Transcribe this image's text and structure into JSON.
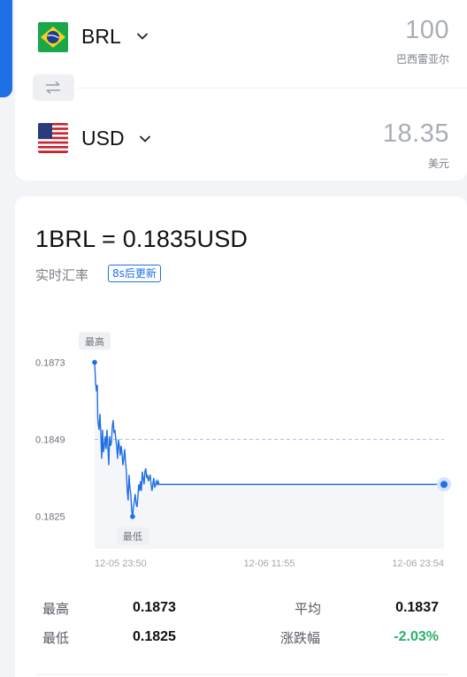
{
  "converter": {
    "from": {
      "flag": "brazil-flag",
      "code": "BRL",
      "amount": "100",
      "name": "巴西雷亚尔"
    },
    "to": {
      "flag": "us-flag",
      "code": "USD",
      "amount": "18.35",
      "name": "美元"
    },
    "swap_icon": "swap-arrows-icon"
  },
  "rate": {
    "title": "1BRL = 0.1835USD",
    "subtitle": "实时汇率",
    "refresh_badge": "8s后更新"
  },
  "chart_data": {
    "type": "line",
    "title": "",
    "xlabel": "",
    "ylabel": "",
    "y_ticks": [
      "0.1873",
      "0.1849",
      "0.1825"
    ],
    "x_ticks": [
      "12-05 23:50",
      "12-06 11:55",
      "12-06 23:54"
    ],
    "ylim": [
      0.1815,
      0.188
    ],
    "average_line": 0.1849,
    "high_label": "最高",
    "low_label": "最低",
    "series": [
      {
        "x": [
          0,
          1,
          2,
          3,
          3.5,
          4,
          5,
          6,
          7,
          8,
          9,
          10,
          11,
          12,
          13,
          14,
          15,
          16,
          17,
          18,
          19,
          20,
          21,
          22,
          23,
          24,
          25,
          26,
          27,
          28,
          29,
          30,
          31,
          32,
          33,
          34,
          35,
          36,
          37,
          38,
          39,
          40,
          41,
          42,
          43,
          44,
          45,
          46,
          47,
          48,
          49,
          50,
          51,
          52,
          53,
          54,
          55,
          56,
          57,
          58,
          59,
          60,
          61,
          62,
          63,
          64,
          65,
          66,
          67,
          68,
          69,
          70,
          71,
          72,
          73,
          74,
          75,
          76,
          77,
          78,
          79,
          80,
          85,
          90,
          100,
          120,
          160,
          200,
          250,
          300,
          350,
          396
        ],
        "y": [
          0.1873,
          0.1867,
          0.1864,
          0.1866,
          0.1856,
          0.1854,
          0.1852,
          0.1857,
          0.1851,
          0.1843,
          0.1852,
          0.1845,
          0.1847,
          0.185,
          0.1846,
          0.1852,
          0.1847,
          0.1841,
          0.185,
          0.1847,
          0.1848,
          0.1853,
          0.1855,
          0.1851,
          0.1852,
          0.1849,
          0.1847,
          0.1843,
          0.1849,
          0.1847,
          0.1844,
          0.1847,
          0.1845,
          0.1841,
          0.1843,
          0.1846,
          0.1842,
          0.1839,
          0.1833,
          0.183,
          0.1838,
          0.1834,
          0.1832,
          0.1827,
          0.1825,
          0.1828,
          0.183,
          0.1832,
          0.1829,
          0.1828,
          0.1831,
          0.1835,
          0.1833,
          0.1836,
          0.1833,
          0.1839,
          0.1837,
          0.1835,
          0.1839,
          0.184,
          0.1837,
          0.1838,
          0.1836,
          0.1837,
          0.1838,
          0.1835,
          0.1833,
          0.1835,
          0.1837,
          0.1834,
          0.1835,
          0.1836,
          0.1835,
          0.1836,
          0.1835,
          0.1835,
          0.1835,
          0.1835,
          0.1835,
          0.1835,
          0.1835,
          0.1835,
          0.1835,
          0.1835,
          0.1835,
          0.1835,
          0.1835,
          0.1835,
          0.1835,
          0.1835,
          0.1835,
          0.1835
        ]
      }
    ],
    "colors": {
      "line": "#1f6fe5",
      "area": "#f4f6fa",
      "avg_line": "#a9c4ee",
      "grid": "#ffffff"
    }
  },
  "stats": {
    "high": {
      "label": "最高",
      "value": "0.1873"
    },
    "low": {
      "label": "最低",
      "value": "0.1825"
    },
    "avg": {
      "label": "平均",
      "value": "0.1837"
    },
    "change": {
      "label": "涨跌幅",
      "value": "-2.03%",
      "color": "#27b36a"
    }
  }
}
